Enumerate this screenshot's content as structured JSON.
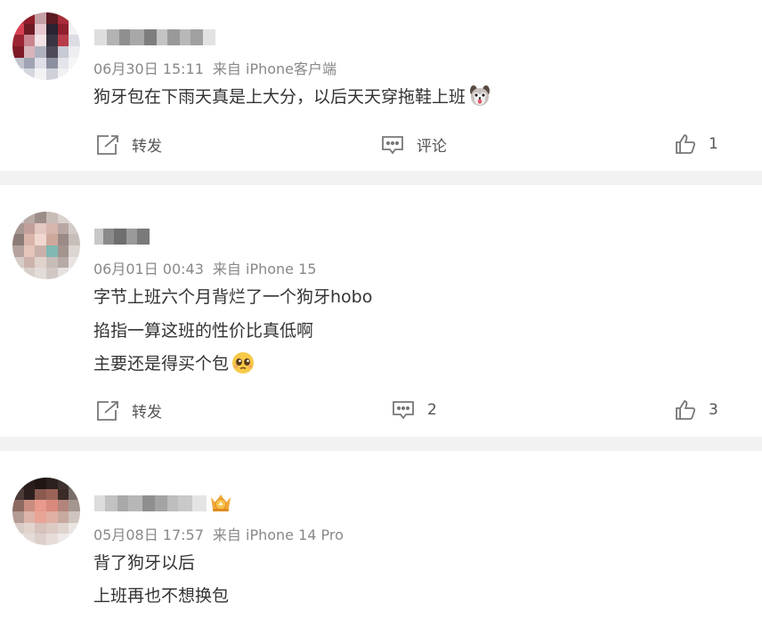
{
  "posts": [
    {
      "time": "06月30日 15:11",
      "source": "来自 iPhone客户端",
      "lines": [
        "狗牙包在下雨天真是上大分，以后天天穿拖鞋上班"
      ],
      "actions": {
        "repost": "转发",
        "comment": "评论",
        "like": "1"
      }
    },
    {
      "time": "06月01日 00:43",
      "source": "来自 iPhone 15",
      "lines": [
        "字节上班六个月背烂了一个狗牙hobo",
        "掐指一算这班的性价比真低啊",
        "主要还是得买个包"
      ],
      "actions": {
        "repost": "转发",
        "comment": "2",
        "like": "3"
      }
    },
    {
      "time": "05月08日 17:57",
      "source": "来自 iPhone 14 Pro",
      "lines": [
        "背了狗牙以后",
        "上班再也不想换包"
      ]
    }
  ],
  "colors": {
    "separator": "#f2f2f2",
    "meta_text": "#888888",
    "body_text": "#333333",
    "icon": "#777777"
  },
  "icons": [
    "repost-icon",
    "comment-icon",
    "like-icon",
    "surprised-dog-emoji",
    "pleading-face-emoji",
    "fan-badge-icon"
  ]
}
